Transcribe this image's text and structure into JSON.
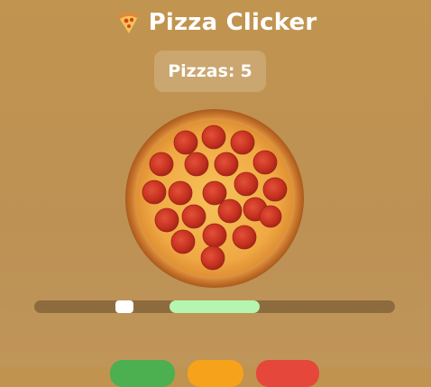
{
  "header": {
    "icon": "pizza-slice-icon",
    "title": "Pizza Clicker"
  },
  "counter": {
    "label": "Pizzas:",
    "value": "5"
  },
  "pizza": {
    "icon": "pepperoni-pizza"
  },
  "timing_bar": {
    "target_zone_start": 0.375,
    "target_zone_end": 0.625,
    "marker_position": 0.225
  },
  "colors": {
    "background": "#c0944f",
    "target_zone": "#b4f5b0",
    "button_green": "#4caf50",
    "button_orange": "#f7a21b",
    "button_red": "#e5483b"
  },
  "buttons": [
    {
      "color": "#4caf50"
    },
    {
      "color": "#f7a21b"
    },
    {
      "color": "#e5483b"
    }
  ]
}
